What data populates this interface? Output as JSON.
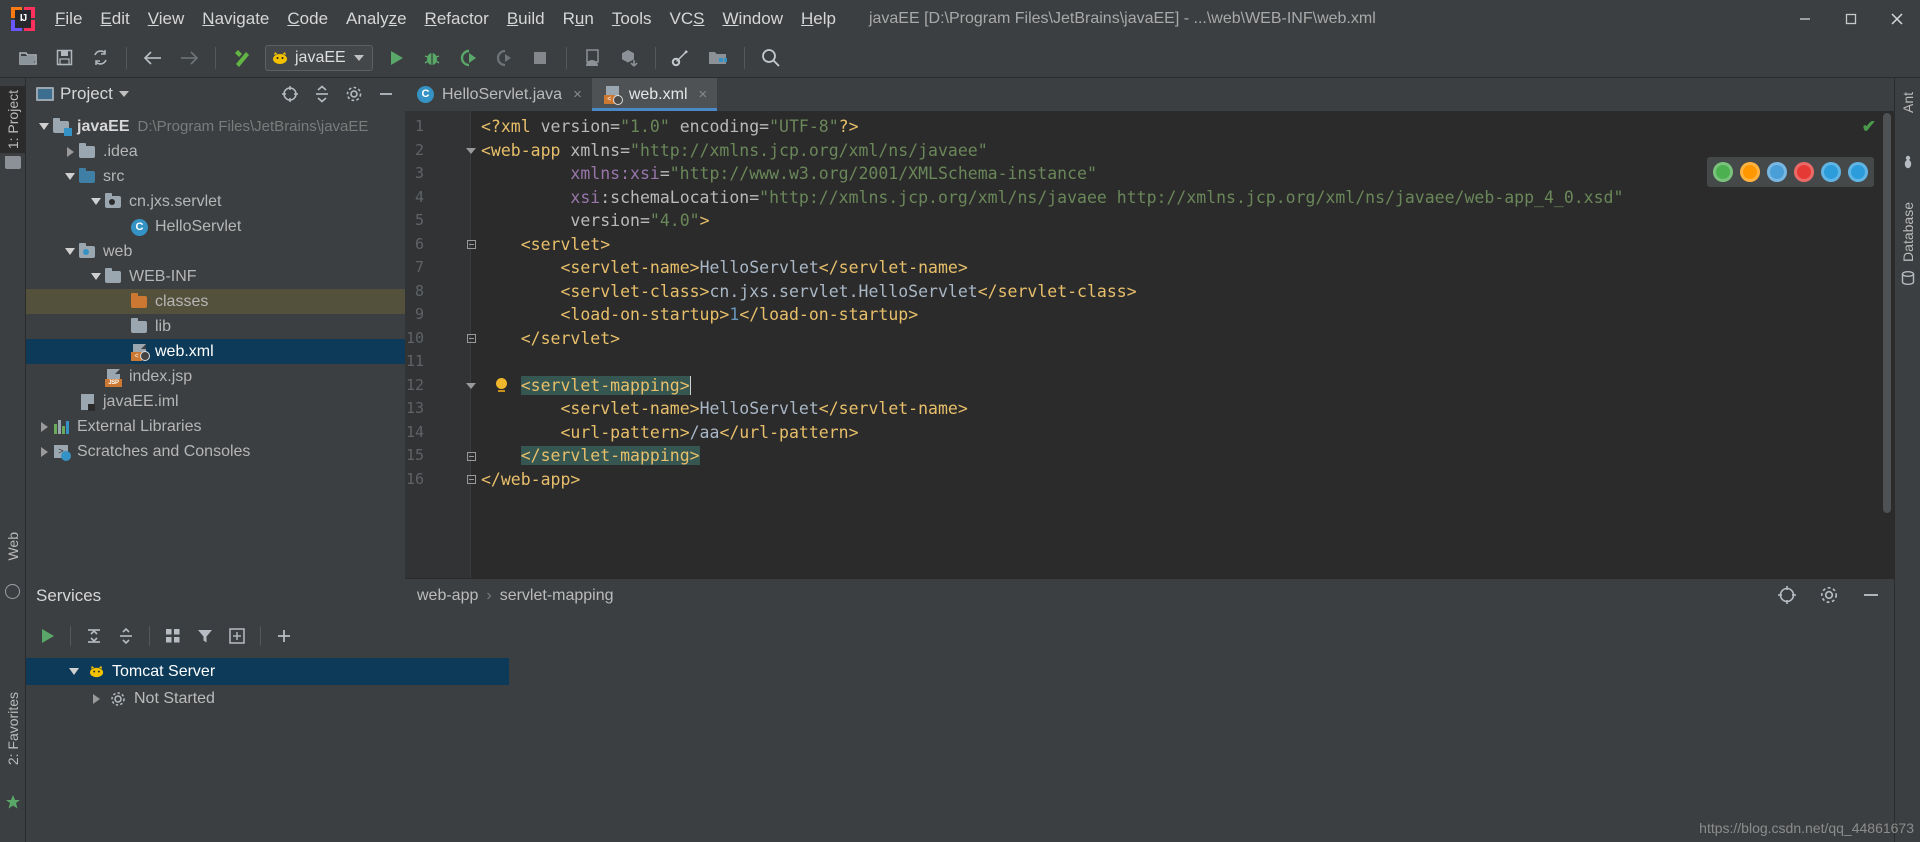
{
  "window": {
    "title": "javaEE [D:\\Program Files\\JetBrains\\javaEE] - ...\\web\\WEB-INF\\web.xml",
    "minimize_label": "Minimize",
    "maximize_label": "Maximize",
    "close_label": "Close"
  },
  "menu": [
    {
      "label": "File",
      "mnemonic": "F"
    },
    {
      "label": "Edit",
      "mnemonic": "E"
    },
    {
      "label": "View",
      "mnemonic": "V"
    },
    {
      "label": "Navigate",
      "mnemonic": "N"
    },
    {
      "label": "Code",
      "mnemonic": "C"
    },
    {
      "label": "Analyze",
      "mnemonic": "z"
    },
    {
      "label": "Refactor",
      "mnemonic": "R"
    },
    {
      "label": "Build",
      "mnemonic": "B"
    },
    {
      "label": "Run",
      "mnemonic": "u"
    },
    {
      "label": "Tools",
      "mnemonic": "T"
    },
    {
      "label": "VCS",
      "mnemonic": "S"
    },
    {
      "label": "Window",
      "mnemonic": "W"
    },
    {
      "label": "Help",
      "mnemonic": "H"
    }
  ],
  "toolbar": {
    "open_label": "Open",
    "save_label": "Save All",
    "sync_label": "Synchronize",
    "back_label": "Back",
    "forward_label": "Forward",
    "build_label": "Build Project",
    "run_config_name": "javaEE",
    "run_label": "Run",
    "debug_label": "Debug",
    "run_coverage_label": "Run with Coverage",
    "profile_label": "Profile",
    "stop_label": "Stop",
    "android_label": "SDK Manager",
    "update_label": "Update Project",
    "settings_label": "Settings",
    "structure_label": "Project Structure"
  },
  "left_tool_strip": [
    {
      "label": "1: Project",
      "selected": true
    },
    {
      "label": "Web",
      "selected": false
    },
    {
      "label": "2: Favorites",
      "selected": false
    }
  ],
  "right_tool_strip": [
    {
      "label": "Ant",
      "selected": false
    },
    {
      "label": "Database",
      "selected": false
    }
  ],
  "project_panel": {
    "title": "Project",
    "locate_icon": "crosshair-icon",
    "collapse_icon": "collapse-all-icon",
    "settings_icon": "gear-icon",
    "hide_icon": "minimize-icon",
    "tree": [
      {
        "indent": 0,
        "twisty": "down",
        "icon": "module-folder",
        "label": "javaEE",
        "bold": true,
        "path": "D:\\Program Files\\JetBrains\\javaEE",
        "state": "normal"
      },
      {
        "indent": 1,
        "twisty": "right",
        "icon": "folder-gray",
        "label": ".idea",
        "state": "normal"
      },
      {
        "indent": 1,
        "twisty": "down",
        "icon": "folder-blue",
        "label": "src",
        "state": "normal"
      },
      {
        "indent": 2,
        "twisty": "down",
        "icon": "package",
        "label": "cn.jxs.servlet",
        "state": "normal"
      },
      {
        "indent": 3,
        "twisty": "none",
        "icon": "class",
        "label": "HelloServlet",
        "state": "normal"
      },
      {
        "indent": 1,
        "twisty": "down",
        "icon": "web-folder",
        "label": "web",
        "state": "normal"
      },
      {
        "indent": 2,
        "twisty": "down",
        "icon": "folder-gray",
        "label": "WEB-INF",
        "state": "normal"
      },
      {
        "indent": 3,
        "twisty": "none",
        "icon": "folder-orange",
        "label": "classes",
        "state": "excluded"
      },
      {
        "indent": 3,
        "twisty": "none",
        "icon": "folder-gray",
        "label": "lib",
        "state": "normal"
      },
      {
        "indent": 3,
        "twisty": "none",
        "icon": "xml-file",
        "label": "web.xml",
        "state": "selected"
      },
      {
        "indent": 2,
        "twisty": "none",
        "icon": "jsp-file",
        "label": "index.jsp",
        "state": "normal"
      },
      {
        "indent": 1,
        "twisty": "none",
        "icon": "iml-file",
        "label": "javaEE.iml",
        "state": "normal"
      },
      {
        "indent": 0,
        "twisty": "right",
        "icon": "libraries",
        "label": "External Libraries",
        "state": "normal"
      },
      {
        "indent": 0,
        "twisty": "right",
        "icon": "scratches",
        "label": "Scratches and Consoles",
        "state": "normal"
      }
    ]
  },
  "editor": {
    "tabs": [
      {
        "label": "HelloServlet.java",
        "icon": "java-class-icon",
        "active": false,
        "close_label": "×"
      },
      {
        "label": "web.xml",
        "icon": "xml-file-icon",
        "active": true,
        "close_label": "×"
      }
    ],
    "inspection_status": "✔",
    "browsers": [
      {
        "name": "chrome-icon",
        "color": "#4caf50"
      },
      {
        "name": "firefox-icon",
        "color": "#ff9800"
      },
      {
        "name": "safari-icon",
        "color": "#4a9fd8"
      },
      {
        "name": "opera-icon",
        "color": "#e53935"
      },
      {
        "name": "edge-legacy-icon",
        "color": "#2d9cdb"
      },
      {
        "name": "edge-icon",
        "color": "#2d9cdb"
      }
    ],
    "line_numbers": [
      "1",
      "2",
      "3",
      "4",
      "5",
      "6",
      "7",
      "8",
      "9",
      "10",
      "11",
      "12",
      "13",
      "14",
      "15",
      "16"
    ],
    "lines": [
      {
        "n": 1,
        "indent": 0,
        "segments": [
          {
            "t": "tagc",
            "v": "<?xml "
          },
          {
            "t": "attr",
            "v": "version="
          },
          {
            "t": "str",
            "v": "\"1.0\""
          },
          {
            "t": "attr",
            "v": " encoding="
          },
          {
            "t": "str",
            "v": "\"UTF-8\""
          },
          {
            "t": "tagc",
            "v": "?>"
          }
        ]
      },
      {
        "n": 2,
        "indent": 0,
        "segments": [
          {
            "t": "tagc",
            "v": "<web-app "
          },
          {
            "t": "attr",
            "v": "xmlns="
          },
          {
            "t": "str",
            "v": "\"http://xmlns.jcp.org/xml/ns/javaee\""
          }
        ]
      },
      {
        "n": 3,
        "indent": 0,
        "segments": [
          {
            "t": "txt",
            "v": "         "
          },
          {
            "t": "ns",
            "v": "xmlns:xsi"
          },
          {
            "t": "attr",
            "v": "="
          },
          {
            "t": "str",
            "v": "\"http://www.w3.org/2001/XMLSchema-instance\""
          }
        ]
      },
      {
        "n": 4,
        "indent": 0,
        "segments": [
          {
            "t": "txt",
            "v": "         "
          },
          {
            "t": "ns",
            "v": "xsi"
          },
          {
            "t": "attr",
            "v": ":schemaLocation="
          },
          {
            "t": "str",
            "v": "\"http://xmlns.jcp.org/xml/ns/javaee http://xmlns.jcp.org/xml/ns/javaee/web-app_4_0.xsd\""
          }
        ]
      },
      {
        "n": 5,
        "indent": 0,
        "segments": [
          {
            "t": "txt",
            "v": "         "
          },
          {
            "t": "attr",
            "v": "version="
          },
          {
            "t": "str",
            "v": "\"4.0\""
          },
          {
            "t": "tagc",
            "v": ">"
          }
        ]
      },
      {
        "n": 6,
        "indent": 0,
        "segments": [
          {
            "t": "txt",
            "v": "    "
          },
          {
            "t": "tagc",
            "v": "<servlet>"
          }
        ]
      },
      {
        "n": 7,
        "indent": 0,
        "segments": [
          {
            "t": "txt",
            "v": "        "
          },
          {
            "t": "tagc",
            "v": "<servlet-name>"
          },
          {
            "t": "txt",
            "v": "HelloServlet"
          },
          {
            "t": "tagc",
            "v": "</servlet-name>"
          }
        ]
      },
      {
        "n": 8,
        "indent": 0,
        "segments": [
          {
            "t": "txt",
            "v": "        "
          },
          {
            "t": "tagc",
            "v": "<servlet-class>"
          },
          {
            "t": "txt",
            "v": "cn.jxs.servlet.HelloServlet"
          },
          {
            "t": "tagc",
            "v": "</servlet-class>"
          }
        ]
      },
      {
        "n": 9,
        "indent": 0,
        "segments": [
          {
            "t": "txt",
            "v": "        "
          },
          {
            "t": "tagc",
            "v": "<load-on-startup>"
          },
          {
            "t": "num",
            "v": "1"
          },
          {
            "t": "tagc",
            "v": "</load-on-startup>"
          }
        ]
      },
      {
        "n": 10,
        "indent": 0,
        "segments": [
          {
            "t": "txt",
            "v": "    "
          },
          {
            "t": "tagc",
            "v": "</servlet>"
          }
        ]
      },
      {
        "n": 11,
        "indent": 0,
        "segments": [
          {
            "t": "txt",
            "v": ""
          }
        ]
      },
      {
        "n": 12,
        "indent": 0,
        "segments": [
          {
            "t": "txt",
            "v": "    "
          },
          {
            "t": "tagc hl",
            "v": "<servlet-mapping>"
          },
          {
            "t": "caret",
            "v": ""
          }
        ]
      },
      {
        "n": 13,
        "indent": 0,
        "segments": [
          {
            "t": "txt",
            "v": "        "
          },
          {
            "t": "tagc",
            "v": "<servlet-name>"
          },
          {
            "t": "txt",
            "v": "HelloServlet"
          },
          {
            "t": "tagc",
            "v": "</servlet-name>"
          }
        ]
      },
      {
        "n": 14,
        "indent": 0,
        "segments": [
          {
            "t": "txt",
            "v": "        "
          },
          {
            "t": "tagc",
            "v": "<url-pattern>"
          },
          {
            "t": "txt",
            "v": "/aa"
          },
          {
            "t": "tagc",
            "v": "</url-pattern>"
          }
        ]
      },
      {
        "n": 15,
        "indent": 0,
        "segments": [
          {
            "t": "txt",
            "v": "    "
          },
          {
            "t": "tagc hl",
            "v": "</servlet-mapping>"
          }
        ]
      },
      {
        "n": 16,
        "indent": 0,
        "segments": [
          {
            "t": "tagc",
            "v": "</web-app>"
          }
        ]
      }
    ],
    "intention_bulb_line": 12,
    "breadcrumb": [
      "web-app",
      "servlet-mapping"
    ],
    "breadcrumb_separator": "›"
  },
  "services": {
    "title": "Services",
    "locate_icon": "crosshair-icon",
    "settings_icon": "gear-icon",
    "hide_icon": "minimize-icon",
    "toolbar": {
      "run_label": "Run",
      "debug_label": "Debug",
      "expand_label": "Expand All",
      "collapse_label": "Collapse All",
      "group_label": "Group",
      "filter_label": "Filter",
      "newwin_label": "New Window",
      "add_label": "Add Service"
    },
    "tree": [
      {
        "label": "Tomcat Server",
        "twisty": "down",
        "icon": "tomcat-icon",
        "selected": true
      },
      {
        "label": "Not Started",
        "twisty": "right",
        "icon": "gear-icon",
        "selected": false
      }
    ]
  },
  "watermark": "https://blog.csdn.net/qq_44861673",
  "colors": {
    "accent": "#4a88c7",
    "selection": "#0d3a58",
    "excluded": "#53503b",
    "tag": "#e8bf6a",
    "string": "#6a8759",
    "namespace": "#9876aa",
    "number": "#6897bb",
    "text": "#a9b7c6",
    "match_highlight": "#365651",
    "editor_bg": "#2b2b2b",
    "panel_bg": "#3c3f41"
  }
}
